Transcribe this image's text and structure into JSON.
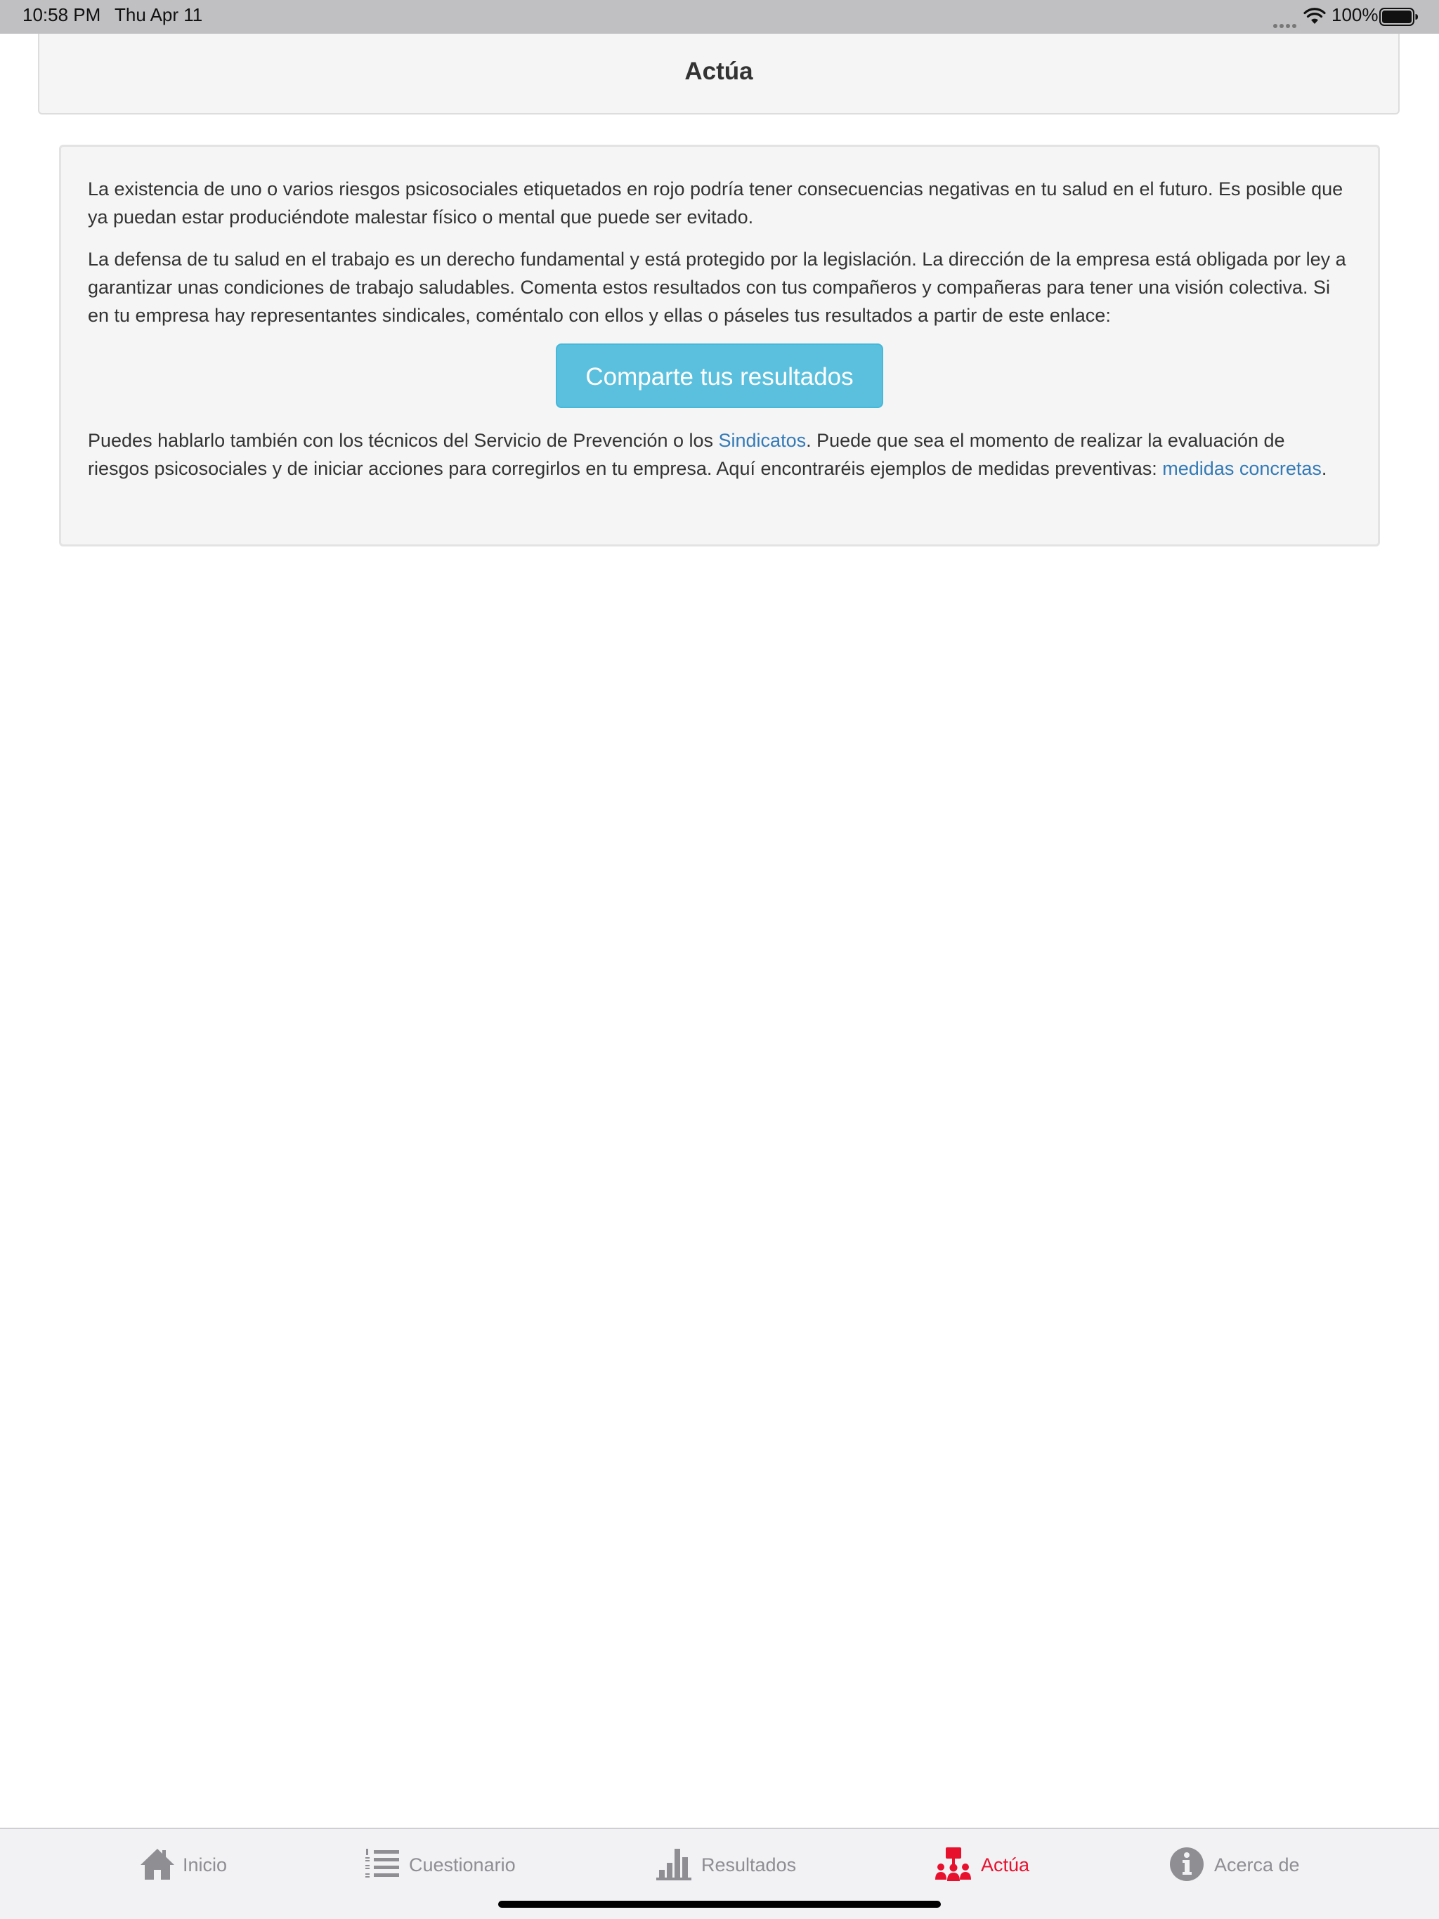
{
  "status_bar": {
    "time": "10:58 PM",
    "date": "Thu Apr 11",
    "battery_percent": "100%",
    "wifi_icon": "wifi-icon",
    "battery_icon": "battery-icon"
  },
  "header": {
    "title": "Actúa"
  },
  "content": {
    "paragraph_1": "La existencia de uno o varios riesgos psicosociales etiquetados en rojo podría tener consecuencias negativas en tu salud en el futuro. Es posible que ya puedan estar produciéndote malestar físico o mental que puede ser evitado.",
    "paragraph_2": "La defensa de tu salud en el trabajo es un derecho fundamental y está protegido por la legislación. La dirección de la empresa está obligada por ley a garantizar unas condiciones de trabajo saludables. Comenta estos resultados con tus compañeros y compañeras para tener una visión colectiva. Si en tu empresa hay representantes sindicales, coméntalo con ellos y ellas o páseles tus resultados a partir de este enlace:",
    "share_button_label": "Comparte tus resultados",
    "paragraph_3_part_1": "Puedes hablarlo también con los técnicos del Servicio de Prevención o los ",
    "link_sindicatos": "Sindicatos",
    "paragraph_3_part_2": ". Puede que sea el momento de realizar la evaluación de riesgos psicosociales y de iniciar acciones para corregirlos en tu empresa. Aquí encontraréis ejemplos de medidas preventivas: ",
    "link_medidas": "medidas concretas",
    "paragraph_3_part_3": "."
  },
  "tab_bar": {
    "active_color": "#e8112d",
    "inactive_color": "#8e8e93",
    "tabs": [
      {
        "label": "Inicio",
        "icon": "home-icon",
        "active": false
      },
      {
        "label": "Cuestionario",
        "icon": "list-icon",
        "active": false
      },
      {
        "label": "Resultados",
        "icon": "bar-chart-icon",
        "active": false
      },
      {
        "label": "Actúa",
        "icon": "group-presentation-icon",
        "active": true
      },
      {
        "label": "Acerca de",
        "icon": "info-icon",
        "active": false
      }
    ]
  }
}
